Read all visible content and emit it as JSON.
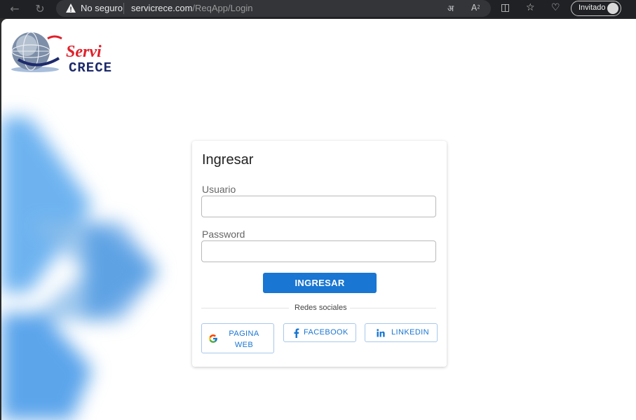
{
  "browser": {
    "security_label": "No seguro",
    "url_domain": "servicrece.com",
    "url_path": "/ReqApp/Login",
    "profile_label": "Invitado"
  },
  "logo": {
    "text_top": "Servi",
    "text_bottom": "CRECE"
  },
  "login": {
    "title": "Ingresar",
    "user_label": "Usuario",
    "user_value": "",
    "password_label": "Password",
    "password_value": "",
    "submit_label": "INGRESAR",
    "social_divider": "Redes sociales",
    "social": [
      {
        "label_line1": "PAGINA",
        "label_line2": "WEB",
        "icon": "google-icon"
      },
      {
        "label": "FACEBOOK",
        "icon": "facebook-icon"
      },
      {
        "label": "LINKEDIN",
        "icon": "linkedin-icon"
      }
    ]
  },
  "colors": {
    "primary": "#1976d2",
    "outline": "#a8c7ea",
    "logo_red": "#e0202a",
    "logo_navy": "#1d2a6b"
  }
}
